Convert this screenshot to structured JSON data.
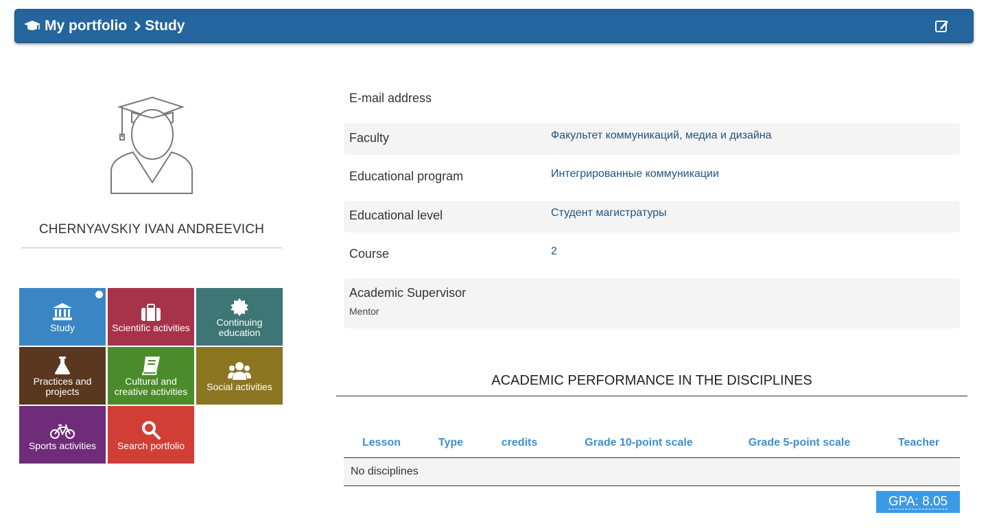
{
  "breadcrumb": {
    "home_label": "My portfolio",
    "current_label": "Study"
  },
  "profile": {
    "name": "CHERNYAVSKIY IVAN ANDREEVICH"
  },
  "tiles": [
    {
      "label": "Study",
      "color": "#3a86c4",
      "icon": "institution-icon"
    },
    {
      "label": "Scientific activities",
      "color": "#a6334a",
      "icon": "briefcase-icon"
    },
    {
      "label": "Continuing education",
      "color": "#3e7575",
      "icon": "certificate-icon"
    },
    {
      "label": "Practices and projects",
      "color": "#5a381f",
      "icon": "flask-icon"
    },
    {
      "label": "Cultural and creative activities",
      "color": "#4c8b2b",
      "icon": "book-icon"
    },
    {
      "label": "Social activities",
      "color": "#8c7520",
      "icon": "users-icon"
    },
    {
      "label": "Sports activities",
      "color": "#6f2c79",
      "icon": "bicycle-icon"
    },
    {
      "label": "Search portfolio",
      "color": "#d13e35",
      "icon": "search-icon"
    }
  ],
  "info": {
    "email": {
      "label": "E-mail address",
      "value": ""
    },
    "faculty": {
      "label": "Faculty",
      "value": "Факультет коммуникаций, медиа и дизайна"
    },
    "program": {
      "label": "Educational program",
      "value": "Интегрированные коммуникации"
    },
    "level": {
      "label": "Educational level",
      "value": "Студент магистратуры"
    },
    "course": {
      "label": "Course",
      "value": "2"
    },
    "supervisor": {
      "label": "Academic Supervisor",
      "sub": "Mentor"
    }
  },
  "performance": {
    "title": "ACADEMIC PERFORMANCE IN THE DISCIPLINES",
    "columns": [
      "Lesson",
      "Type",
      "credits",
      "Grade 10-point scale",
      "Grade 5-point scale",
      "Teacher"
    ],
    "empty_text": "No disciplines",
    "gpa": "GPA: 8.05"
  },
  "colors": {
    "header_bar": "#23659c",
    "link": "#23527c",
    "table_header": "#3d8fd1",
    "gpa_badge": "#3a9ae8"
  }
}
